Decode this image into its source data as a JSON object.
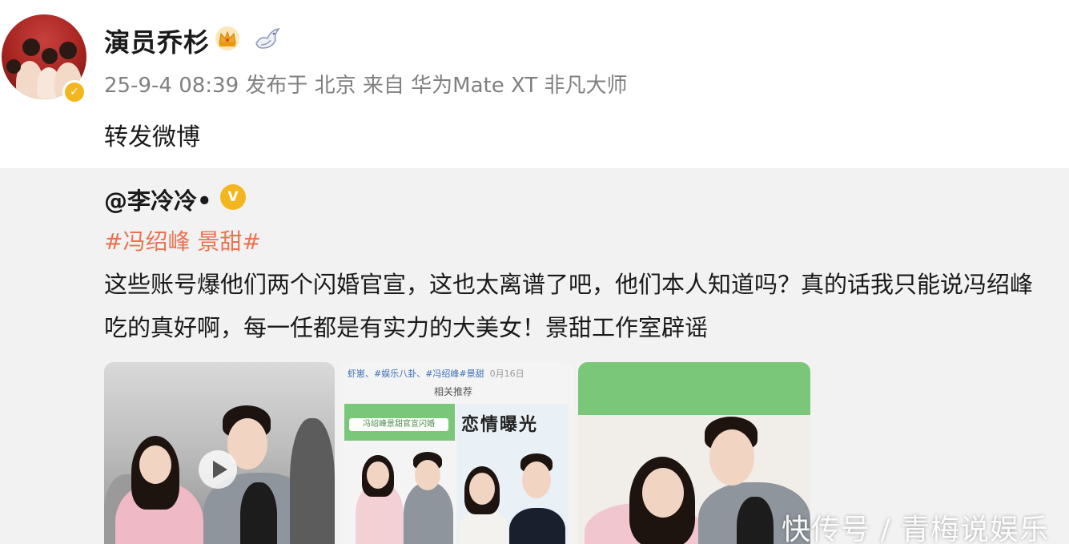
{
  "post": {
    "username": "演员乔杉",
    "meta": "25-9-4 08:39 发布于 北京 来自 华为Mate XT 非凡大师",
    "repost_text": "转发微博"
  },
  "repost": {
    "author": "@李冷冷•",
    "hashtag": "#冯绍峰 景甜#",
    "body": "这些账号爆他们两个闪婚官宣，这也太离谱了吧，他们本人知道吗？真的话我只能说冯绍峰吃的真好啊，每一任都是有实力的大美女！景甜工作室辟谣"
  },
  "images": {
    "image2_header": "虾崽、#娱乐八卦、#冯绍峰#景甜",
    "image2_date": "0月16日",
    "image2_sub": "相关推荐",
    "image2_banner": "冯绍峰景甜官宣闪婚",
    "image2_caption": "恋情曝光"
  },
  "watermark": "快传号 / 青梅说娱乐",
  "colors": {
    "hashtag": "#eb7350",
    "verify_gold": "#f3b61f",
    "meta_gray": "#808080",
    "card_bg": "#f2f2f2",
    "banner_green": "#7bc77a"
  },
  "icons": {
    "crown": "crown-icon",
    "dove": "dove-icon",
    "verify": "verified-badge-icon",
    "play": "play-icon"
  }
}
